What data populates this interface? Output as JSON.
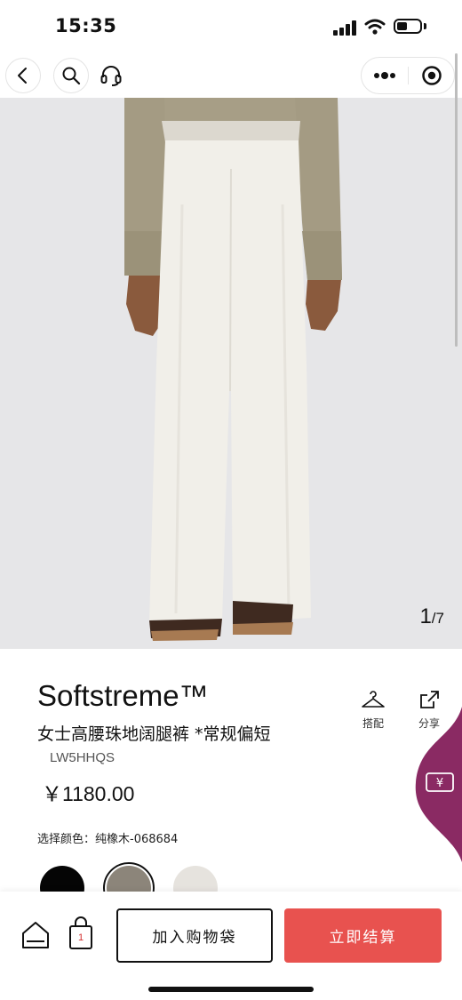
{
  "status_bar": {
    "time": "15:35",
    "battery_level": 0.45,
    "icons": [
      "signal-icon",
      "wifi-icon",
      "battery-icon"
    ]
  },
  "nav": {
    "icons": [
      "back-icon",
      "search-icon",
      "headset-icon",
      "more-dots-icon",
      "close-miniprogram-icon"
    ]
  },
  "gallery": {
    "current": "1",
    "separator": "/",
    "total": "7"
  },
  "product": {
    "name": "Softstreme™",
    "subtitle": "女士高腰珠地阔腿裤 *常规偏短",
    "code": "LW5HHQS",
    "price": "￥1180.00"
  },
  "actions": {
    "outfit_label": "搭配",
    "share_label": "分享"
  },
  "colors": {
    "label": "选择颜色：纯橡木-068684",
    "swatches": [
      {
        "hex": "#050505"
      },
      {
        "hex": "#8c857a"
      },
      {
        "hex": "#e6e3de"
      }
    ],
    "selected_index": 1
  },
  "coupon": {
    "icon_text": "¥",
    "color": "#8a2a63"
  },
  "bottom_bar": {
    "bag_count": "1",
    "add_to_bag": "加入购物袋",
    "checkout": "立即结算",
    "checkout_color": "#e8524f"
  }
}
